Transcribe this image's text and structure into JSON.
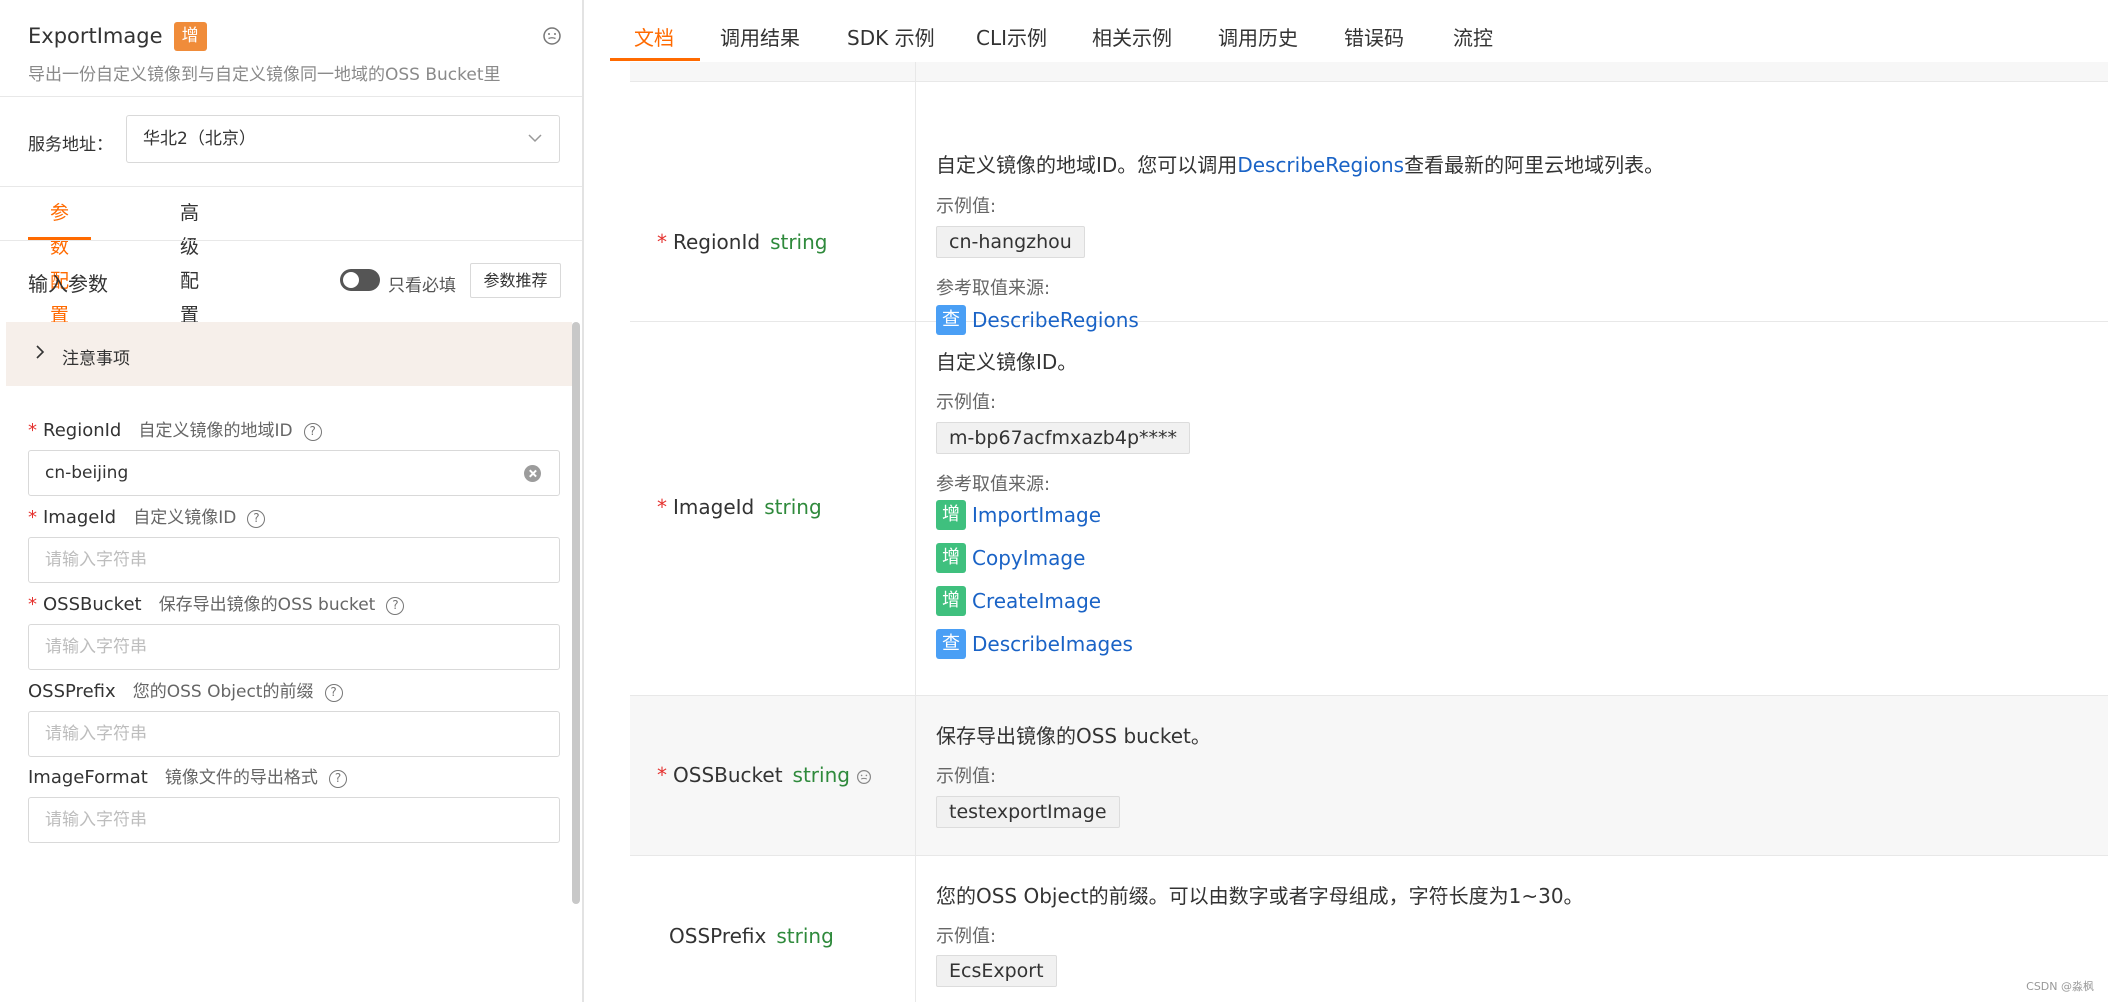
{
  "api": {
    "name": "ExportImage",
    "badge": "增",
    "description": "导出一份自定义镜像到与自定义镜像同一地域的OSS Bucket里"
  },
  "service": {
    "label": "服务地址：",
    "value": "华北2（北京）"
  },
  "config_tabs": [
    {
      "label": "参数配置",
      "active": true
    },
    {
      "label": "高级配置",
      "active": false
    }
  ],
  "input_params": {
    "title": "输入参数",
    "toggle_label": "只看必填",
    "recommend_button": "参数推荐"
  },
  "notice": {
    "label": "注意事项"
  },
  "form_fields": [
    {
      "name": "RegionId",
      "required": true,
      "hint": "自定义镜像的地域ID",
      "value": "cn-beijing",
      "placeholder": "请输入字符串"
    },
    {
      "name": "ImageId",
      "required": true,
      "hint": "自定义镜像ID",
      "value": "",
      "placeholder": "请输入字符串"
    },
    {
      "name": "OSSBucket",
      "required": true,
      "hint": "保存导出镜像的OSS bucket",
      "value": "",
      "placeholder": "请输入字符串"
    },
    {
      "name": "OSSPrefix",
      "required": false,
      "hint": "您的OSS Object的前缀",
      "value": "",
      "placeholder": "请输入字符串"
    },
    {
      "name": "ImageFormat",
      "required": false,
      "hint": "镜像文件的导出格式",
      "value": "",
      "placeholder": "请输入字符串"
    }
  ],
  "doc_tabs": [
    {
      "label": "文档",
      "active": true
    },
    {
      "label": "调用结果",
      "active": false
    },
    {
      "label": "SDK 示例",
      "active": false
    },
    {
      "label": "CLI示例",
      "active": false
    },
    {
      "label": "相关示例",
      "active": false
    },
    {
      "label": "调用历史",
      "active": false
    },
    {
      "label": "错误码",
      "active": false
    },
    {
      "label": "流控",
      "active": false
    }
  ],
  "doc": {
    "example_label": "示例值:",
    "ref_label": "参考取值来源:",
    "rows": [
      {
        "name": "RegionId",
        "type": "string",
        "required": true,
        "desc_before": "自定义镜像的地域ID。您可以调用",
        "desc_link": "DescribeRegions",
        "desc_after": "查看最新的阿里云地域列表。",
        "example": "cn-hangzhou",
        "refs": [
          {
            "tag": "查",
            "kind": "query",
            "label": "DescribeRegions"
          }
        ]
      },
      {
        "name": "ImageId",
        "type": "string",
        "required": true,
        "desc_before": "自定义镜像ID。",
        "desc_link": "",
        "desc_after": "",
        "example": "m-bp67acfmxazb4p****",
        "refs": [
          {
            "tag": "增",
            "kind": "add",
            "label": "ImportImage"
          },
          {
            "tag": "增",
            "kind": "add",
            "label": "CopyImage"
          },
          {
            "tag": "增",
            "kind": "add",
            "label": "CreateImage"
          },
          {
            "tag": "查",
            "kind": "query",
            "label": "DescribeImages"
          }
        ]
      },
      {
        "name": "OSSBucket",
        "type": "string",
        "required": true,
        "desc_before": "保存导出镜像的OSS bucket。",
        "desc_link": "",
        "desc_after": "",
        "example": "testexportImage",
        "refs": []
      },
      {
        "name": "OSSPrefix",
        "type": "string",
        "required": false,
        "desc_before": "您的OSS Object的前缀。可以由数字或者字母组成，字符长度为1~30。",
        "desc_link": "",
        "desc_after": "",
        "example": "EcsExport",
        "refs": []
      }
    ]
  },
  "watermark": "CSDN @淼枫"
}
